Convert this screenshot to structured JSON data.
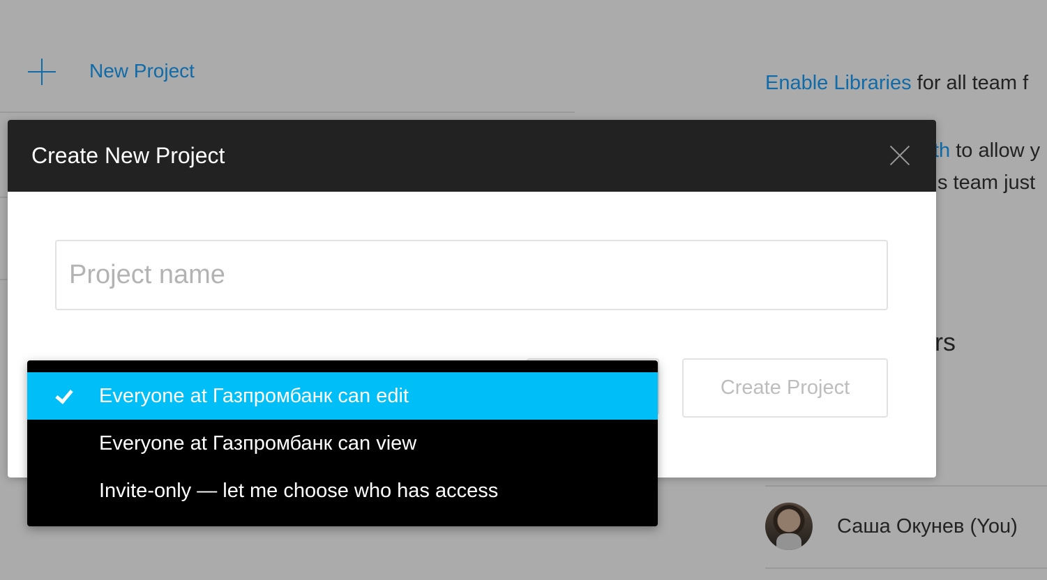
{
  "page": {
    "new_project_label": "New Project",
    "libraries": {
      "link": "Enable Libraries",
      "rest": " for all team f"
    },
    "partial_link": "th",
    "partial_text_1": " to allow y",
    "partial_text_2": "s team just",
    "members_heading": "rs",
    "member": {
      "name": "Саша Окунев (You)"
    }
  },
  "modal": {
    "title": "Create New Project",
    "name_input": {
      "placeholder": "Project name",
      "value": ""
    },
    "create_button_label": "Create Project",
    "permissions": {
      "options": [
        {
          "label": "Everyone at Газпромбанк can edit",
          "selected": true
        },
        {
          "label": "Everyone at Газпромбанк can view",
          "selected": false
        },
        {
          "label": "Invite-only — let me choose who has access",
          "selected": false
        }
      ]
    }
  },
  "colors": {
    "accent": "#18a0fb",
    "selected_option": "#00bef8",
    "modal_header": "#222222",
    "dropdown_bg": "#000000"
  },
  "icons": [
    "plus-icon",
    "close-icon",
    "checkmark-icon",
    "avatar"
  ]
}
